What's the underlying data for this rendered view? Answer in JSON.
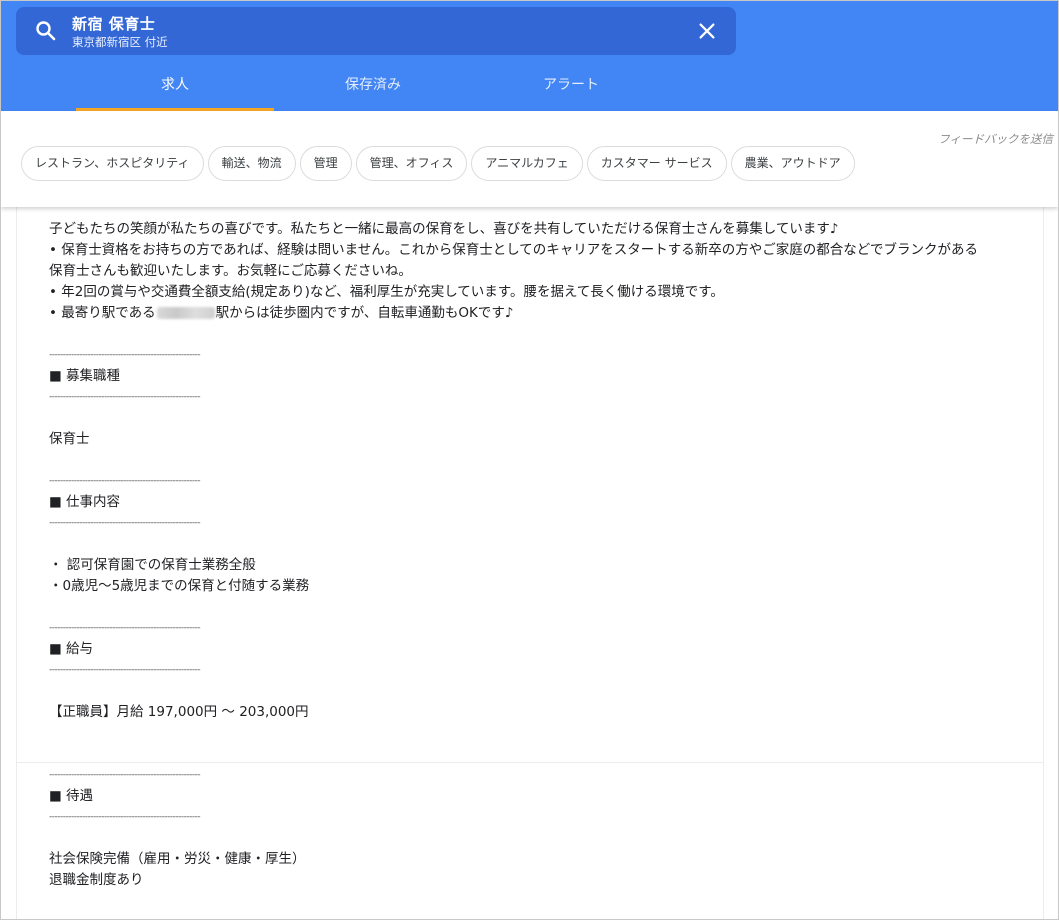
{
  "search": {
    "query": "新宿 保育士",
    "location": "東京都新宿区 付近"
  },
  "tabs": [
    {
      "label": "求人",
      "active": true
    },
    {
      "label": "保存済み",
      "active": false
    },
    {
      "label": "アラート",
      "active": false
    }
  ],
  "feedback_label": "フィードバックを送信",
  "chips": [
    "レストラン、ホスピタリティ",
    "輸送、物流",
    "管理",
    "管理、オフィス",
    "アニマルカフェ",
    "カスタマー サービス",
    "農業、アウトドア"
  ],
  "description": {
    "intro": "子どもたちの笑顔が私たちの喜びです。私たちと一緒に最高の保育をし、喜びを共有していただける保育士さんを募集しています♪",
    "bullet1a": "• 保育士資格をお持ちの方であれば、経験は問いません。これから保育士としてのキャリアをスタートする新卒の方やご家庭の都合などでブランクがある",
    "bullet1b": "保育士さんも歓迎いたします。お気軽にご応募くださいね。",
    "bullet2": "• 年2回の賞与や交通費全額支給(規定あり)など、福利厚生が充実しています。腰を据えて長く働ける環境です。",
    "bullet3_pre": "• 最寄り駅である",
    "bullet3_post": "駅からは徒歩圏内ですが、自転車通勤もOKです♪",
    "divider": "-------------------------------------------------------",
    "sections": [
      {
        "heading": "■ 募集職種",
        "lines": [
          "保育士"
        ]
      },
      {
        "heading": "■ 仕事内容",
        "lines": [
          "・ 認可保育園での保育士業務全般",
          "・0歳児〜5歳児までの保育と付随する業務"
        ]
      },
      {
        "heading": "■ 給与",
        "lines": [
          "【正職員】月給 197,000円 〜 203,000円"
        ]
      },
      {
        "heading": "■ 待遇",
        "lines": [
          "社会保険完備（雇用・労災・健康・厚生）",
          "退職金制度あり"
        ]
      }
    ]
  },
  "colors": {
    "header": "#4285f4",
    "search_box": "#3367d6",
    "tab_indicator": "#f5a623"
  }
}
